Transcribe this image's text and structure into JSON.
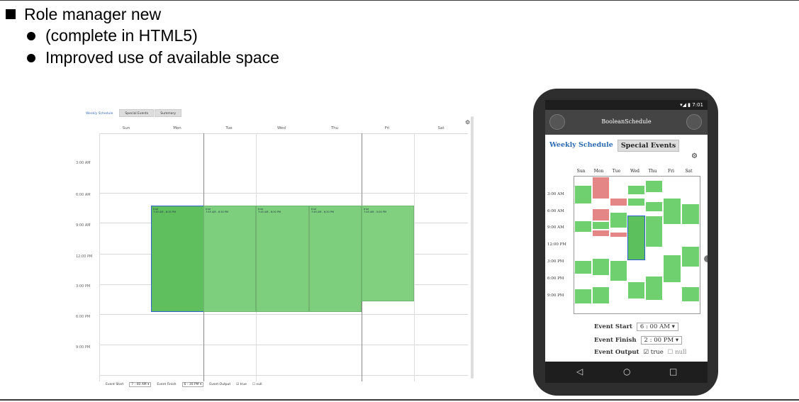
{
  "slide": {
    "title": "Role manager new",
    "bullets": [
      "(complete in HTML5)",
      "Improved use of available space"
    ]
  },
  "desktop": {
    "tabs": [
      "Weekly Schedule",
      "Special Events",
      "Summary"
    ],
    "days": [
      "Sun",
      "Mon",
      "Tue",
      "Wed",
      "Thu",
      "Fri",
      "Sat"
    ],
    "times": [
      "3:00 AM",
      "6:00 AM",
      "9:00 AM",
      "12:00 PM",
      "3:00 PM",
      "6:00 PM",
      "9:00 PM"
    ],
    "events": [
      {
        "label": "true",
        "detail": "7:45 AM - 6:30 PM"
      },
      {
        "label": "true",
        "detail": "7:45 AM - 6:30 PM"
      },
      {
        "label": "true",
        "detail": "7:45 AM - 6:30 PM"
      },
      {
        "label": "true",
        "detail": "7:45 AM - 6:30 PM"
      },
      {
        "label": "true",
        "detail": "7:45 AM - 5:00 PM"
      }
    ],
    "footer": {
      "start_label": "Event Start",
      "start_value": "7 : 00 AM ▾",
      "finish_label": "Event Finish",
      "finish_value": "6 : 30 PM ▾",
      "output_label": "Event Output",
      "opt_true": "true",
      "opt_null": "null"
    }
  },
  "phone": {
    "status_time": "7:01",
    "app_title": "BooleanSchedule",
    "tabs": [
      "Weekly Schedule",
      "Special Events"
    ],
    "days": [
      "Sun",
      "Mon",
      "Tue",
      "Wed",
      "Thu",
      "Fri",
      "Sat"
    ],
    "times": [
      "3:00 AM",
      "6:00 AM",
      "9:00 AM",
      "12:00 PM",
      "3:00 PM",
      "6:00 PM",
      "9:00 PM"
    ],
    "event_start_label": "Event Start",
    "event_start_value": "6 : 00  AM ▾",
    "event_finish_label": "Event Finish",
    "event_finish_value": "2 : 00  PM ▾",
    "event_output_label": "Event Output",
    "opt_true": "true",
    "opt_null": "null",
    "nav": [
      "◁",
      "○",
      "□"
    ]
  }
}
